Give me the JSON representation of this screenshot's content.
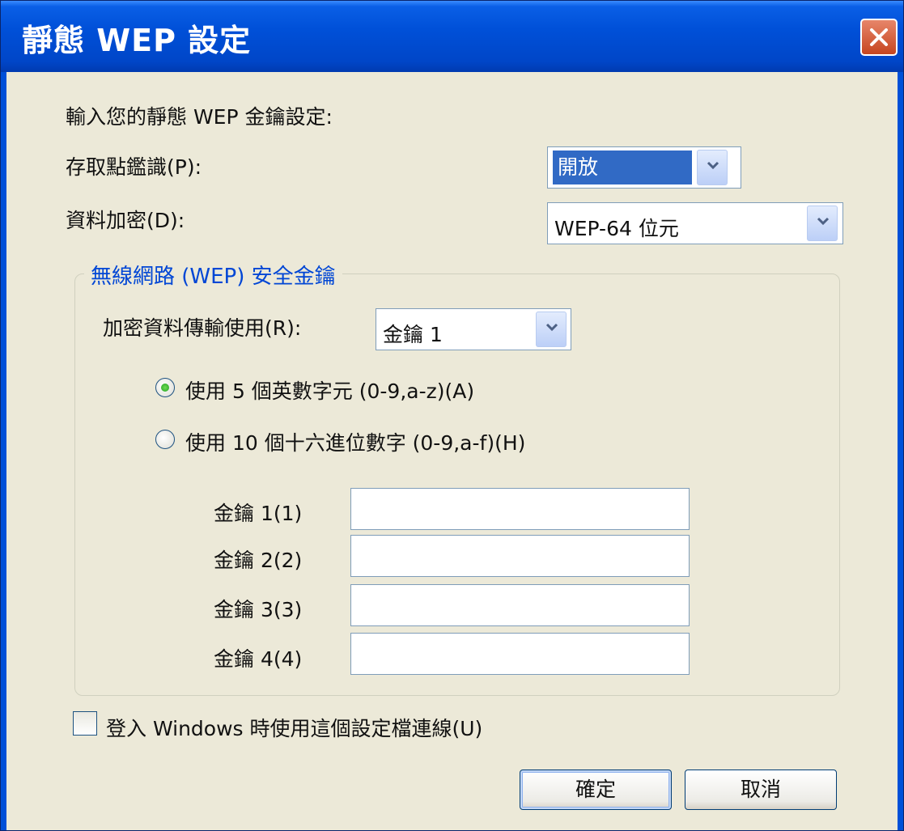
{
  "window": {
    "title": "靜態 WEP 設定"
  },
  "intro": "輸入您的靜態 WEP 金鑰設定:",
  "access_point": {
    "label": "存取點鑑識(P):",
    "value": "開放"
  },
  "data_encryption": {
    "label": "資料加密(D):",
    "value": "WEP-64 位元"
  },
  "group": {
    "title": "無線網路 (WEP) 安全金鑰",
    "transmit_label": "加密資料傳輸使用(R):",
    "transmit_value": "金鑰 1",
    "radio_ascii": "使用 5 個英數字元 (0-9,a-z)(A)",
    "radio_hex": "使用 10 個十六進位數字 (0-9,a-f)(H)",
    "keys": [
      {
        "label": "金鑰 1(1)",
        "value": ""
      },
      {
        "label": "金鑰 2(2)",
        "value": ""
      },
      {
        "label": "金鑰 3(3)",
        "value": ""
      },
      {
        "label": "金鑰 4(4)",
        "value": ""
      }
    ]
  },
  "login_checkbox": "登入 Windows 時使用這個設定檔連線(U)",
  "buttons": {
    "ok": "確定",
    "cancel": "取消"
  },
  "icons": {
    "close": "close-icon",
    "dropdown": "chevron-down-icon"
  },
  "colors": {
    "titlebar": "#0050d8",
    "selection": "#316ac5",
    "group_title": "#0046d5"
  }
}
